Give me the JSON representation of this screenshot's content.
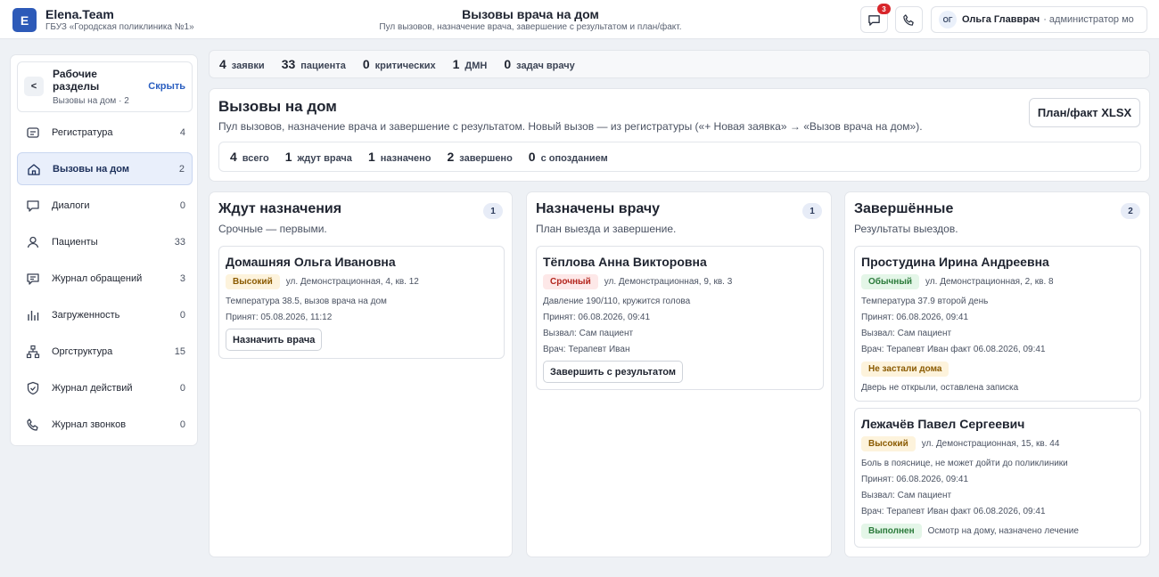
{
  "header": {
    "logo_letter": "E",
    "brand_name": "Elena.Team",
    "org_name": "ГБУЗ «Городская поликлиника №1»",
    "title": "Вызовы врача на дом",
    "subtitle": "Пул вызовов, назначение врача, завершение с результатом и план/факт.",
    "notifications_count": "3",
    "user_initials": "ОГ",
    "user_name": "Ольга Главврач",
    "user_role": "· администратор мо"
  },
  "sidebar": {
    "back_label": "<",
    "title": "Рабочие разделы",
    "subtitle": "Вызовы на дом · 2",
    "hide_label": "Скрыть",
    "items": [
      {
        "label": "Регистратура",
        "count": "4",
        "icon": "registry-icon"
      },
      {
        "label": "Вызовы на дом",
        "count": "2",
        "icon": "home-icon"
      },
      {
        "label": "Диалоги",
        "count": "0",
        "icon": "chat-icon"
      },
      {
        "label": "Пациенты",
        "count": "33",
        "icon": "user-icon"
      },
      {
        "label": "Журнал обращений",
        "count": "3",
        "icon": "journal-icon"
      },
      {
        "label": "Загруженность",
        "count": "0",
        "icon": "bar-chart-icon"
      },
      {
        "label": "Оргструктура",
        "count": "15",
        "icon": "org-icon"
      },
      {
        "label": "Журнал действий",
        "count": "0",
        "icon": "shield-icon"
      },
      {
        "label": "Журнал звонков",
        "count": "0",
        "icon": "phone-icon"
      }
    ]
  },
  "stats": [
    {
      "value": "4",
      "label": "заявки"
    },
    {
      "value": "33",
      "label": "пациента"
    },
    {
      "value": "0",
      "label": "критических"
    },
    {
      "value": "1",
      "label": "ДМН"
    },
    {
      "value": "0",
      "label": "задач врачу"
    }
  ],
  "page": {
    "title": "Вызовы на дом",
    "description": "Пул вызовов, назначение врача и завершение с результатом. Новый вызов — из регистратуры («+ Новая заявка» → «Вызов врача на дом»).",
    "export_label": "План/факт XLSX",
    "substats": [
      {
        "value": "4",
        "label": "всего"
      },
      {
        "value": "1",
        "label": "ждут врача"
      },
      {
        "value": "1",
        "label": "назначено"
      },
      {
        "value": "2",
        "label": "завершено"
      },
      {
        "value": "0",
        "label": "с опозданием"
      }
    ]
  },
  "columns": {
    "waiting": {
      "title": "Ждут назначения",
      "subtitle": "Срочные — первыми.",
      "count": "1",
      "cards": [
        {
          "name": "Домашняя Ольга Ивановна",
          "priority": "Высокий",
          "address": "ул. Демонстрационная, 4, кв. 12",
          "complaint": "Температура 38.5, вызов врача на дом",
          "accepted": "Принят: 05.08.2026, 11:12",
          "action": "Назначить врача"
        }
      ]
    },
    "assigned": {
      "title": "Назначены врачу",
      "subtitle": "План выезда и завершение.",
      "count": "1",
      "cards": [
        {
          "name": "Тёплова Анна Викторовна",
          "priority": "Срочный",
          "address": "ул. Демонстрационная, 9, кв. 3",
          "complaint": "Давление 190/110, кружится голова",
          "accepted": "Принят: 06.08.2026, 09:41",
          "caller": "Вызвал: Сам пациент",
          "doctor": "Врач: Терапевт Иван",
          "action": "Завершить с результатом"
        }
      ]
    },
    "done": {
      "title": "Завершённые",
      "subtitle": "Результаты выездов.",
      "count": "2",
      "cards": [
        {
          "name": "Простудина Ирина Андреевна",
          "priority": "Обычный",
          "address": "ул. Демонстрационная, 2, кв. 8",
          "complaint": "Температура 37.9 второй день",
          "accepted": "Принят: 06.08.2026, 09:41",
          "caller": "Вызвал: Сам пациент",
          "doctor": "Врач: Терапевт Иван  факт 06.08.2026, 09:41",
          "result": "Не застали дома",
          "result_note": "Дверь не открыли, оставлена записка"
        },
        {
          "name": "Лежачёв Павел Сергеевич",
          "priority": "Высокий",
          "address": "ул. Демонстрационная, 15, кв. 44",
          "complaint": "Боль в пояснице, не может дойти до поликлиники",
          "accepted": "Принят: 06.08.2026, 09:41",
          "caller": "Вызвал: Сам пациент",
          "doctor": "Врач: Терапевт Иван  факт 06.08.2026, 09:41",
          "result": "Выполнен",
          "result_note": "Осмотр на дому, назначено лечение"
        }
      ]
    }
  }
}
